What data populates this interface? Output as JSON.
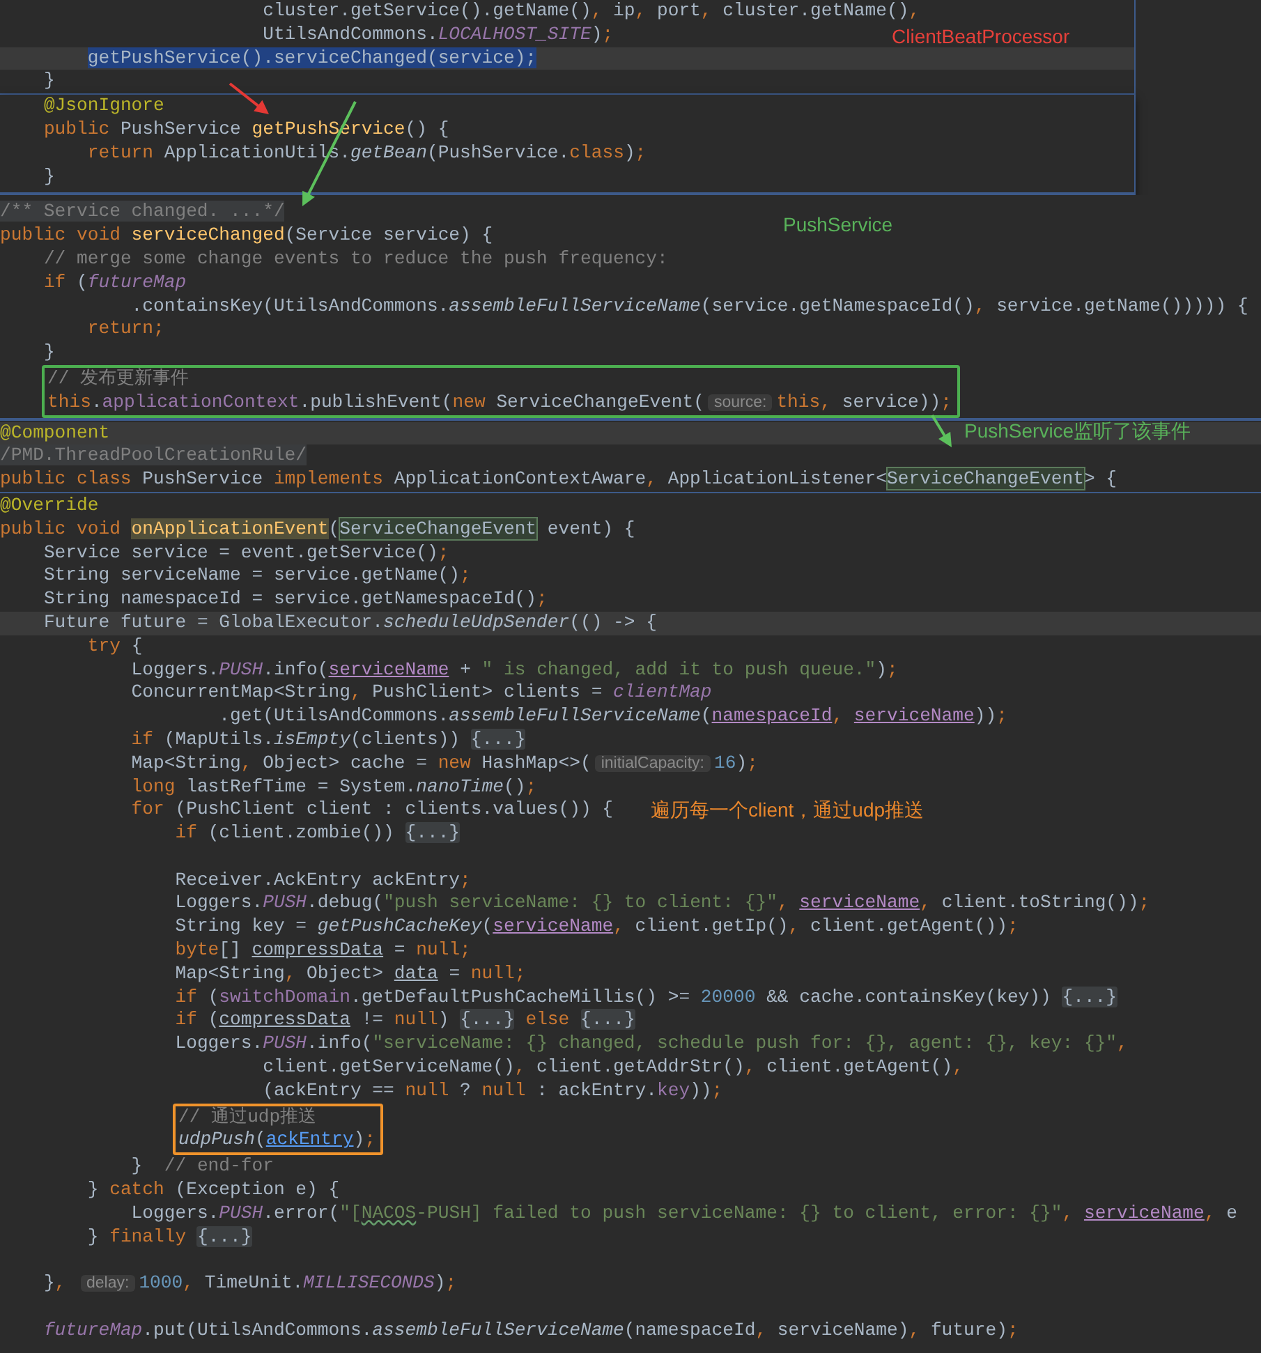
{
  "panels": [
    {
      "kind": "popup",
      "lines": [
        {
          "kind": "line",
          "current": false,
          "tokens": [
            {
              "kind": "p",
              "text": "                        cluster.getService().getName()"
            },
            {
              "kind": "kw",
              "text": ", "
            },
            {
              "kind": "p",
              "text": "ip"
            },
            {
              "kind": "kw",
              "text": ", "
            },
            {
              "kind": "p",
              "text": "port"
            },
            {
              "kind": "kw",
              "text": ", "
            },
            {
              "kind": "p",
              "text": "cluster.getName()"
            },
            {
              "kind": "kw",
              "text": ","
            }
          ]
        },
        {
          "kind": "line",
          "current": false,
          "tokens": [
            {
              "kind": "p",
              "text": "                        UtilsAndCommons."
            },
            {
              "kind": "sf",
              "text": "LOCALHOST_SITE"
            },
            {
              "kind": "p",
              "text": ")"
            },
            {
              "kind": "kw",
              "text": ";"
            }
          ]
        },
        {
          "kind": "line",
          "current": true,
          "tokens": [
            {
              "kind": "sel",
              "text": "        getPushService().serviceChanged(service);"
            }
          ]
        },
        {
          "kind": "line",
          "current": false,
          "tokens": [
            {
              "kind": "p",
              "text": "    }"
            }
          ]
        }
      ]
    },
    {
      "kind": "popup",
      "lines": [
        {
          "kind": "line",
          "current": false,
          "tokens": [
            {
              "kind": "ann",
              "text": "    @JsonIgnore"
            }
          ]
        },
        {
          "kind": "line",
          "current": false,
          "tokens": [
            {
              "kind": "kw",
              "text": "    public "
            },
            {
              "kind": "p",
              "text": "PushService "
            },
            {
              "kind": "md",
              "text": "getPushService"
            },
            {
              "kind": "p",
              "text": "() {"
            }
          ]
        },
        {
          "kind": "line",
          "current": false,
          "tokens": [
            {
              "kind": "kw",
              "text": "        return "
            },
            {
              "kind": "p",
              "text": "ApplicationUtils."
            },
            {
              "kind": "sm",
              "text": "getBean"
            },
            {
              "kind": "p",
              "text": "(PushService."
            },
            {
              "kind": "kw",
              "text": "class"
            },
            {
              "kind": "p",
              "text": ")"
            },
            {
              "kind": "kw",
              "text": ";"
            }
          ]
        },
        {
          "kind": "line",
          "current": false,
          "tokens": [
            {
              "kind": "p",
              "text": "    }"
            }
          ]
        }
      ]
    },
    {
      "kind": "editor",
      "lines": [
        {
          "kind": "line",
          "current": false,
          "tokens": [
            {
              "kind": "doc",
              "text": "/** Service changed. ...*/"
            }
          ]
        },
        {
          "kind": "line",
          "current": false,
          "tokens": [
            {
              "kind": "kw",
              "text": "public void "
            },
            {
              "kind": "md",
              "text": "serviceChanged"
            },
            {
              "kind": "p",
              "text": "(Service service) {"
            }
          ]
        },
        {
          "kind": "line",
          "current": false,
          "tokens": [
            {
              "kind": "cm",
              "text": "    // merge some change events to reduce the push frequency:"
            }
          ]
        },
        {
          "kind": "line",
          "current": false,
          "tokens": [
            {
              "kind": "kw",
              "text": "    if "
            },
            {
              "kind": "p",
              "text": "("
            },
            {
              "kind": "sf",
              "text": "futureMap"
            }
          ]
        },
        {
          "kind": "line",
          "current": false,
          "tokens": [
            {
              "kind": "p",
              "text": "            .containsKey(UtilsAndCommons."
            },
            {
              "kind": "sm",
              "text": "assembleFullServiceName"
            },
            {
              "kind": "p",
              "text": "(service.getNamespaceId()"
            },
            {
              "kind": "kw",
              "text": ", "
            },
            {
              "kind": "p",
              "text": "service.getName())))) {"
            }
          ]
        },
        {
          "kind": "line",
          "current": false,
          "tokens": [
            {
              "kind": "kw",
              "text": "        return;"
            }
          ]
        },
        {
          "kind": "line",
          "current": false,
          "tokens": [
            {
              "kind": "p",
              "text": "    }"
            }
          ]
        },
        {
          "kind": "box",
          "color": "#4caf50",
          "lines": [
            {
              "kind": "line",
              "current": false,
              "tokens": [
                {
                  "kind": "cm",
                  "text": "// 发布更新事件"
                }
              ]
            },
            {
              "kind": "line",
              "current": false,
              "tokens": [
                {
                  "kind": "kw",
                  "text": "this"
                },
                {
                  "kind": "p",
                  "text": "."
                },
                {
                  "kind": "f",
                  "text": "applicationContext"
                },
                {
                  "kind": "p",
                  "text": ".publishEvent("
                },
                {
                  "kind": "kw",
                  "text": "new "
                },
                {
                  "kind": "p",
                  "text": "ServiceChangeEvent("
                },
                {
                  "kind": "hint",
                  "text": "source:"
                },
                {
                  "kind": "kw",
                  "text": "this"
                },
                {
                  "kind": "kw",
                  "text": ", "
                },
                {
                  "kind": "p",
                  "text": "service))"
                },
                {
                  "kind": "kw",
                  "text": ";"
                }
              ]
            }
          ]
        }
      ]
    },
    {
      "kind": "editor",
      "lines": [
        {
          "kind": "line",
          "current": true,
          "tokens": [
            {
              "kind": "ann",
              "text": "@Component"
            }
          ]
        },
        {
          "kind": "line",
          "current": false,
          "tokens": [
            {
              "kind": "doc",
              "text": "/PMD.ThreadPoolCreationRule/"
            }
          ]
        },
        {
          "kind": "line",
          "current": false,
          "tokens": [
            {
              "kind": "kw",
              "text": "public class "
            },
            {
              "kind": "p",
              "text": "PushService "
            },
            {
              "kind": "kw",
              "text": "implements "
            },
            {
              "kind": "p",
              "text": "ApplicationContextAware"
            },
            {
              "kind": "kw",
              "text": ", "
            },
            {
              "kind": "p",
              "text": "ApplicationListener<"
            },
            {
              "kind": "usage",
              "text": "ServiceChangeEvent"
            },
            {
              "kind": "p",
              "text": "> {"
            }
          ]
        }
      ]
    },
    {
      "kind": "editor",
      "lines": [
        {
          "kind": "line",
          "current": false,
          "tokens": [
            {
              "kind": "ann",
              "text": "@Override"
            }
          ]
        },
        {
          "kind": "line",
          "current": false,
          "tokens": [
            {
              "kind": "kw",
              "text": "public void "
            },
            {
              "kind": "mdhl",
              "text": "onApplicationEvent"
            },
            {
              "kind": "p",
              "text": "("
            },
            {
              "kind": "usage",
              "text": "ServiceChangeEvent"
            },
            {
              "kind": "p",
              "text": " event) {"
            }
          ]
        },
        {
          "kind": "line",
          "current": false,
          "tokens": [
            {
              "kind": "p",
              "text": "    Service service = event.getService()"
            },
            {
              "kind": "kw",
              "text": ";"
            }
          ]
        },
        {
          "kind": "line",
          "current": false,
          "tokens": [
            {
              "kind": "p",
              "text": "    String serviceName = service.getName()"
            },
            {
              "kind": "kw",
              "text": ";"
            }
          ]
        },
        {
          "kind": "line",
          "current": false,
          "tokens": [
            {
              "kind": "p",
              "text": "    String namespaceId = service.getNamespaceId()"
            },
            {
              "kind": "kw",
              "text": ";"
            }
          ]
        },
        {
          "kind": "line",
          "current": true,
          "tokens": [
            {
              "kind": "p",
              "text": "    Future future = GlobalExecutor."
            },
            {
              "kind": "sm",
              "text": "scheduleUdpSender"
            },
            {
              "kind": "p",
              "text": "(() -> {"
            }
          ]
        },
        {
          "kind": "line",
          "current": false,
          "tokens": [
            {
              "kind": "kw",
              "text": "        try "
            },
            {
              "kind": "p",
              "text": "{"
            }
          ]
        },
        {
          "kind": "line",
          "current": false,
          "tokens": [
            {
              "kind": "p",
              "text": "            Loggers."
            },
            {
              "kind": "sf",
              "text": "PUSH"
            },
            {
              "kind": "p",
              "text": ".info("
            },
            {
              "kind": "cap",
              "text": "serviceName"
            },
            {
              "kind": "p",
              "text": " + "
            },
            {
              "kind": "str",
              "text": "\" is changed, add it to push queue.\""
            },
            {
              "kind": "p",
              "text": ")"
            },
            {
              "kind": "kw",
              "text": ";"
            }
          ]
        },
        {
          "kind": "line",
          "current": false,
          "tokens": [
            {
              "kind": "p",
              "text": "            ConcurrentMap<String"
            },
            {
              "kind": "kw",
              "text": ", "
            },
            {
              "kind": "p",
              "text": "PushClient> clients = "
            },
            {
              "kind": "sf",
              "text": "clientMap"
            }
          ]
        },
        {
          "kind": "line",
          "current": false,
          "tokens": [
            {
              "kind": "p",
              "text": "                    .get(UtilsAndCommons."
            },
            {
              "kind": "sm",
              "text": "assembleFullServiceName"
            },
            {
              "kind": "p",
              "text": "("
            },
            {
              "kind": "cap",
              "text": "namespaceId"
            },
            {
              "kind": "kw",
              "text": ", "
            },
            {
              "kind": "cap",
              "text": "serviceName"
            },
            {
              "kind": "p",
              "text": "))"
            },
            {
              "kind": "kw",
              "text": ";"
            }
          ]
        },
        {
          "kind": "line",
          "current": false,
          "tokens": [
            {
              "kind": "kw",
              "text": "            if "
            },
            {
              "kind": "p",
              "text": "(MapUtils."
            },
            {
              "kind": "sm",
              "text": "isEmpty"
            },
            {
              "kind": "p",
              "text": "(clients)) "
            },
            {
              "kind": "fold",
              "text": "{...}"
            }
          ]
        },
        {
          "kind": "line",
          "current": false,
          "tokens": [
            {
              "kind": "p",
              "text": "            Map<String"
            },
            {
              "kind": "kw",
              "text": ", "
            },
            {
              "kind": "p",
              "text": "Object> cache = "
            },
            {
              "kind": "kw",
              "text": "new "
            },
            {
              "kind": "p",
              "text": "HashMap<>("
            },
            {
              "kind": "hint",
              "text": "initialCapacity:"
            },
            {
              "kind": "num",
              "text": "16"
            },
            {
              "kind": "p",
              "text": ")"
            },
            {
              "kind": "kw",
              "text": ";"
            }
          ]
        },
        {
          "kind": "line",
          "current": false,
          "tokens": [
            {
              "kind": "kw",
              "text": "            long "
            },
            {
              "kind": "p",
              "text": "lastRefTime = System."
            },
            {
              "kind": "sm",
              "text": "nanoTime"
            },
            {
              "kind": "p",
              "text": "()"
            },
            {
              "kind": "kw",
              "text": ";"
            }
          ]
        },
        {
          "kind": "line",
          "current": false,
          "tokens": [
            {
              "kind": "kw",
              "text": "            for "
            },
            {
              "kind": "p",
              "text": "(PushClient client : clients.values()) {"
            }
          ]
        },
        {
          "kind": "line",
          "current": false,
          "tokens": [
            {
              "kind": "kw",
              "text": "                if "
            },
            {
              "kind": "p",
              "text": "(client.zombie()) "
            },
            {
              "kind": "fold",
              "text": "{...}"
            }
          ]
        },
        {
          "kind": "line",
          "current": false
        },
        {
          "kind": "line",
          "current": false,
          "tokens": [
            {
              "kind": "p",
              "text": "                Receiver.AckEntry ackEntry"
            },
            {
              "kind": "kw",
              "text": ";"
            }
          ]
        },
        {
          "kind": "line",
          "current": false,
          "tokens": [
            {
              "kind": "p",
              "text": "                Loggers."
            },
            {
              "kind": "sf",
              "text": "PUSH"
            },
            {
              "kind": "p",
              "text": ".debug("
            },
            {
              "kind": "str",
              "text": "\"push serviceName: {} to client: {}\""
            },
            {
              "kind": "kw",
              "text": ", "
            },
            {
              "kind": "cap",
              "text": "serviceName"
            },
            {
              "kind": "kw",
              "text": ", "
            },
            {
              "kind": "p",
              "text": "client.toString())"
            },
            {
              "kind": "kw",
              "text": ";"
            }
          ]
        },
        {
          "kind": "line",
          "current": false,
          "tokens": [
            {
              "kind": "p",
              "text": "                String key = "
            },
            {
              "kind": "sm",
              "text": "getPushCacheKey"
            },
            {
              "kind": "p",
              "text": "("
            },
            {
              "kind": "cap",
              "text": "serviceName"
            },
            {
              "kind": "kw",
              "text": ", "
            },
            {
              "kind": "p",
              "text": "client.getIp()"
            },
            {
              "kind": "kw",
              "text": ", "
            },
            {
              "kind": "p",
              "text": "client.getAgent())"
            },
            {
              "kind": "kw",
              "text": ";"
            }
          ]
        },
        {
          "kind": "line",
          "current": false,
          "tokens": [
            {
              "kind": "kw",
              "text": "                byte"
            },
            {
              "kind": "p",
              "text": "[] "
            },
            {
              "kind": "ul",
              "text": "compressData"
            },
            {
              "kind": "p",
              "text": " = "
            },
            {
              "kind": "kw",
              "text": "null;"
            }
          ]
        },
        {
          "kind": "line",
          "current": false,
          "tokens": [
            {
              "kind": "p",
              "text": "                Map<String"
            },
            {
              "kind": "kw",
              "text": ", "
            },
            {
              "kind": "p",
              "text": "Object> "
            },
            {
              "kind": "ul",
              "text": "data"
            },
            {
              "kind": "p",
              "text": " = "
            },
            {
              "kind": "kw",
              "text": "null;"
            }
          ]
        },
        {
          "kind": "line",
          "current": false,
          "tokens": [
            {
              "kind": "kw",
              "text": "                if "
            },
            {
              "kind": "p",
              "text": "("
            },
            {
              "kind": "f",
              "text": "switchDomain"
            },
            {
              "kind": "p",
              "text": ".getDefaultPushCacheMillis() >= "
            },
            {
              "kind": "num",
              "text": "20000"
            },
            {
              "kind": "p",
              "text": " && cache.containsKey(key)) "
            },
            {
              "kind": "fold",
              "text": "{...}"
            }
          ]
        },
        {
          "kind": "line",
          "current": false,
          "tokens": [
            {
              "kind": "kw",
              "text": "                if "
            },
            {
              "kind": "p",
              "text": "("
            },
            {
              "kind": "ul",
              "text": "compressData"
            },
            {
              "kind": "p",
              "text": " != "
            },
            {
              "kind": "kw",
              "text": "null"
            },
            {
              "kind": "p",
              "text": ") "
            },
            {
              "kind": "fold",
              "text": "{...}"
            },
            {
              "kind": "kw",
              "text": " else "
            },
            {
              "kind": "fold",
              "text": "{...}"
            }
          ]
        },
        {
          "kind": "line",
          "current": false,
          "tokens": [
            {
              "kind": "p",
              "text": "                Loggers."
            },
            {
              "kind": "sf",
              "text": "PUSH"
            },
            {
              "kind": "p",
              "text": ".info("
            },
            {
              "kind": "str",
              "text": "\"serviceName: {} changed, schedule push for: {}, agent: {}, key: {}\""
            },
            {
              "kind": "kw",
              "text": ","
            }
          ]
        },
        {
          "kind": "line",
          "current": false,
          "tokens": [
            {
              "kind": "p",
              "text": "                        client.getServiceName()"
            },
            {
              "kind": "kw",
              "text": ", "
            },
            {
              "kind": "p",
              "text": "client.getAddrStr()"
            },
            {
              "kind": "kw",
              "text": ", "
            },
            {
              "kind": "p",
              "text": "client.getAgent()"
            },
            {
              "kind": "kw",
              "text": ","
            }
          ]
        },
        {
          "kind": "line",
          "current": false,
          "tokens": [
            {
              "kind": "p",
              "text": "                        (ackEntry == "
            },
            {
              "kind": "kw",
              "text": "null "
            },
            {
              "kind": "p",
              "text": "? "
            },
            {
              "kind": "kw",
              "text": "null "
            },
            {
              "kind": "p",
              "text": ": ackEntry."
            },
            {
              "kind": "f",
              "text": "key"
            },
            {
              "kind": "p",
              "text": "))"
            },
            {
              "kind": "kw",
              "text": ";"
            }
          ]
        },
        {
          "kind": "box",
          "color": "#f0932b",
          "lines": [
            {
              "kind": "line",
              "current": false,
              "tokens": [
                {
                  "kind": "cm",
                  "text": "// 通过udp推送"
                }
              ]
            },
            {
              "kind": "line",
              "current": false,
              "tokens": [
                {
                  "kind": "sm",
                  "text": "udpPush"
                },
                {
                  "kind": "p",
                  "text": "("
                },
                {
                  "kind": "link",
                  "text": "ackEntry"
                },
                {
                  "kind": "p",
                  "text": ")"
                },
                {
                  "kind": "kw",
                  "text": ";"
                }
              ]
            }
          ]
        },
        {
          "kind": "line",
          "current": false,
          "tokens": [
            {
              "kind": "p",
              "text": "            }  "
            },
            {
              "kind": "cm",
              "text": "// end-for"
            }
          ]
        },
        {
          "kind": "line",
          "current": false,
          "tokens": [
            {
              "kind": "p",
              "text": "        } "
            },
            {
              "kind": "kw",
              "text": "catch "
            },
            {
              "kind": "p",
              "text": "(Exception e) {"
            }
          ]
        },
        {
          "kind": "line",
          "current": false,
          "tokens": [
            {
              "kind": "p",
              "text": "            Loggers."
            },
            {
              "kind": "sf",
              "text": "PUSH"
            },
            {
              "kind": "p",
              "text": ".error("
            },
            {
              "kind": "str",
              "text": "\"["
            },
            {
              "kind": "typo",
              "text": "NACOS"
            },
            {
              "kind": "str",
              "text": "-PUSH] failed to push serviceName: {} to client, error: {}\""
            },
            {
              "kind": "kw",
              "text": ", "
            },
            {
              "kind": "cap",
              "text": "serviceName"
            },
            {
              "kind": "kw",
              "text": ", "
            },
            {
              "kind": "p",
              "text": "e"
            }
          ]
        },
        {
          "kind": "line",
          "current": false,
          "tokens": [
            {
              "kind": "p",
              "text": "        } "
            },
            {
              "kind": "kw",
              "text": "finally "
            },
            {
              "kind": "fold",
              "text": "{...}"
            }
          ]
        },
        {
          "kind": "line",
          "current": false
        },
        {
          "kind": "line",
          "current": false,
          "tokens": [
            {
              "kind": "p",
              "text": "    }"
            },
            {
              "kind": "kw",
              "text": ", "
            },
            {
              "kind": "hint",
              "text": "delay:"
            },
            {
              "kind": "num",
              "text": "1000"
            },
            {
              "kind": "kw",
              "text": ", "
            },
            {
              "kind": "p",
              "text": "TimeUnit."
            },
            {
              "kind": "sf",
              "text": "MILLISECONDS"
            },
            {
              "kind": "p",
              "text": ")"
            },
            {
              "kind": "kw",
              "text": ";"
            }
          ]
        },
        {
          "kind": "line",
          "current": false
        },
        {
          "kind": "line",
          "current": false,
          "tokens": [
            {
              "kind": "sf",
              "text": "    futureMap"
            },
            {
              "kind": "p",
              "text": ".put(UtilsAndCommons."
            },
            {
              "kind": "sm",
              "text": "assembleFullServiceName"
            },
            {
              "kind": "p",
              "text": "(namespaceId"
            },
            {
              "kind": "kw",
              "text": ", "
            },
            {
              "kind": "p",
              "text": "serviceName)"
            },
            {
              "kind": "kw",
              "text": ", "
            },
            {
              "kind": "p",
              "text": "future)"
            },
            {
              "kind": "kw",
              "text": ";"
            }
          ]
        }
      ]
    }
  ],
  "callouts": [
    {
      "text": "ClientBeatProcessor",
      "color": "#e8403a"
    },
    {
      "text": "PushService",
      "color": "#59b25a"
    },
    {
      "text": "PushService监听了该事件",
      "color": "#59b25a"
    },
    {
      "text": "遍历每一个client，通过udp推送",
      "color": "#e8862c"
    }
  ]
}
